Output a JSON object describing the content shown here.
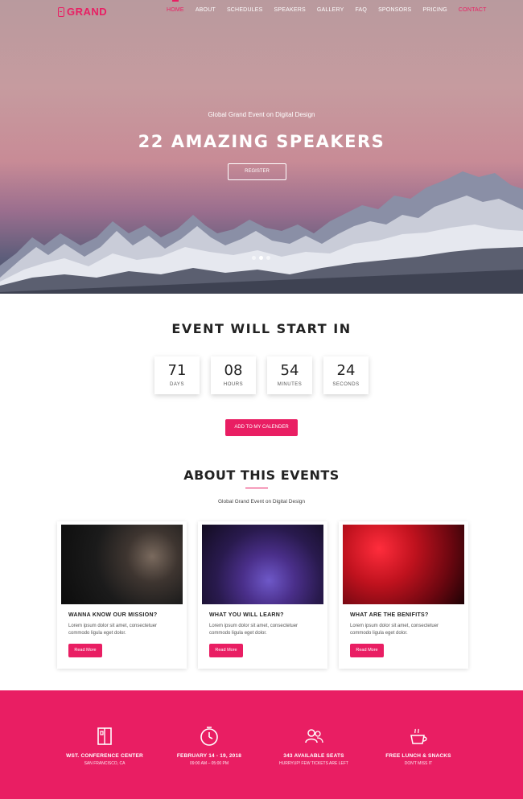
{
  "nav": {
    "logo": "GRAND",
    "items": [
      "HOME",
      "ABOUT",
      "SCHEDULES",
      "SPEAKERS",
      "GALLERY",
      "FAQ",
      "SPONSORS",
      "PRICING",
      "CONTACT"
    ]
  },
  "hero": {
    "subtitle": "Global Grand Event on Digital Design",
    "title": "22 AMAZING SPEAKERS",
    "button": "REGISTER"
  },
  "countdown": {
    "title": "EVENT WILL START IN",
    "units": [
      {
        "value": "71",
        "label": "DAYS"
      },
      {
        "value": "08",
        "label": "HOURS"
      },
      {
        "value": "54",
        "label": "MINUTES"
      },
      {
        "value": "24",
        "label": "SECONDS"
      }
    ],
    "button": "ADD TO MY CALENDER"
  },
  "about": {
    "title": "ABOUT THIS EVENTS",
    "subtitle": "Global Grand Event on Digital Design",
    "cards": [
      {
        "title": "WANNA KNOW OUR MISSION?",
        "text": "Lorem ipsum dolor sit amet, consectetuer commodo ligula eget dolor.",
        "button": "Read More"
      },
      {
        "title": "WHAT YOU WILL LEARN?",
        "text": "Lorem ipsum dolor sit amet, consectetuer commodo ligula eget dolor.",
        "button": "Read More"
      },
      {
        "title": "WHAT ARE THE BENIFITS?",
        "text": "Lorem ipsum dolor sit amet, consectetuer commodo ligula eget dolor.",
        "button": "Read More"
      }
    ]
  },
  "features": [
    {
      "icon": "building-icon",
      "title": "WST. CONFERENCE CENTER",
      "sub": "SAN FRANCISCO, CA"
    },
    {
      "icon": "clock-icon",
      "title": "FEBRUARY 14 - 19, 2018",
      "sub": "09:00 AM – 05:00 PM"
    },
    {
      "icon": "users-icon",
      "title": "343 AVAILABLE SEATS",
      "sub": "HURRYUP! FEW TICKETS ARE LEFT"
    },
    {
      "icon": "coffee-cup-icon",
      "title": "FREE LUNCH & SNACKS",
      "sub": "DON'T MISS IT"
    }
  ],
  "colors": {
    "accent": "#e91e63"
  }
}
